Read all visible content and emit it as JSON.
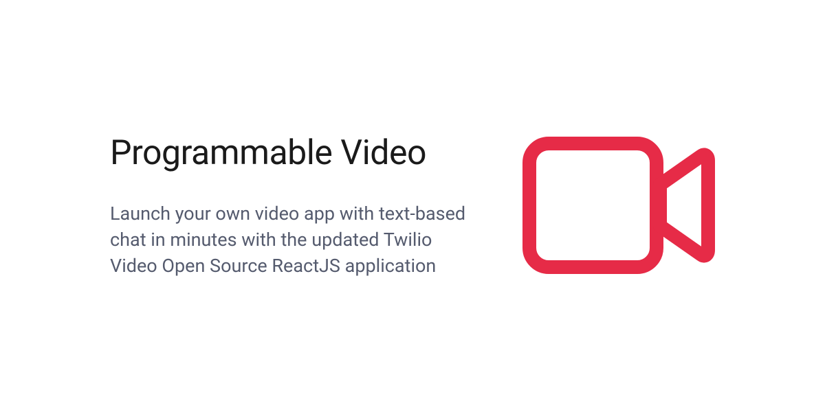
{
  "title": "Programmable Video",
  "description": "Launch your own video app with text-based chat in minutes with the updated Twilio Video Open Source ReactJS application",
  "icon_color": "#e62b47"
}
